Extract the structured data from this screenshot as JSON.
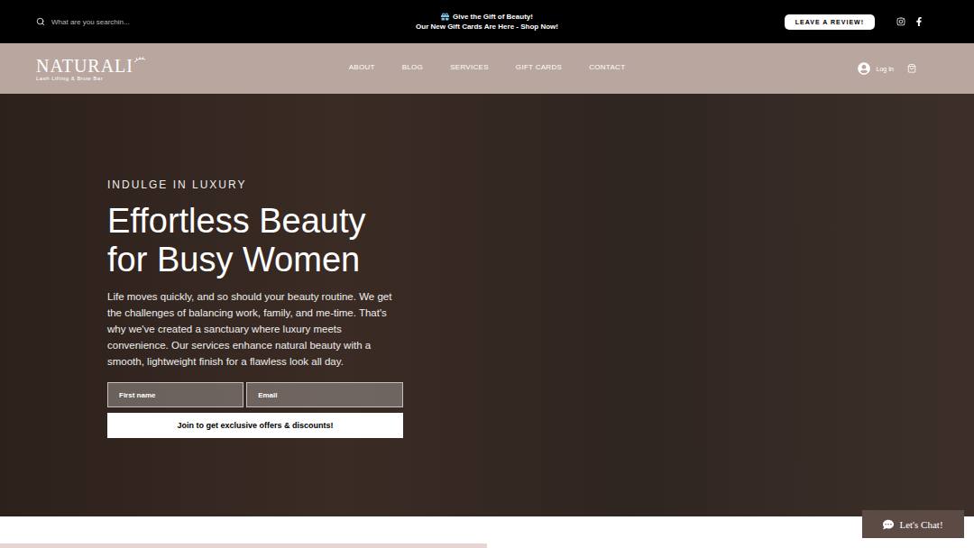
{
  "announcement": {
    "search_placeholder": "What are you searchin...",
    "line1": "Give the Gift of Beauty!",
    "line2": "Our New Gift Cards Are Here - Shop Now!",
    "review_button": "LEAVE A REVIEW!"
  },
  "header": {
    "logo": "NATURALI",
    "logo_tagline": "Lash Lifting & Brow Bar",
    "nav": [
      "ABOUT",
      "BLOG",
      "SERVICES",
      "GIFT CARDS",
      "CONTACT"
    ],
    "login": "Log In"
  },
  "hero": {
    "eyebrow": "INDULGE IN LUXURY",
    "title_lines": [
      "Effortless Beauty",
      "for Busy Women"
    ],
    "body": "Life moves quickly, and so should your beauty routine. We get the challenges of balancing work, family, and me-time. That's why we've created a sanctuary where luxury meets convenience. Our services enhance natural beauty with a smooth, lightweight finish for a flawless look all day.",
    "fields": [
      {
        "placeholder": "First name"
      },
      {
        "placeholder": "Email"
      }
    ],
    "submit": "Join to get exclusive offers & discounts!"
  },
  "chat": {
    "label": "Let's Chat!"
  }
}
